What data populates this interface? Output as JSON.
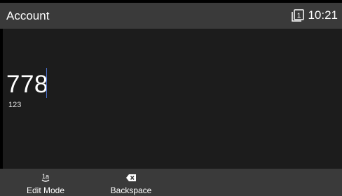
{
  "header": {
    "title": "Account",
    "line_indicator": "1",
    "time": "10:21"
  },
  "input": {
    "value": "778",
    "mode": "123"
  },
  "softkeys": [
    {
      "label": "Edit Mode",
      "icon": "input-mode-icon",
      "icon_text": "1a"
    },
    {
      "label": "Backspace",
      "icon": "backspace-icon"
    }
  ],
  "colors": {
    "titlebar": "#3a3a3a",
    "content_bg": "#1c1c1c",
    "caret": "#4a6ec9",
    "text": "#ffffff"
  }
}
